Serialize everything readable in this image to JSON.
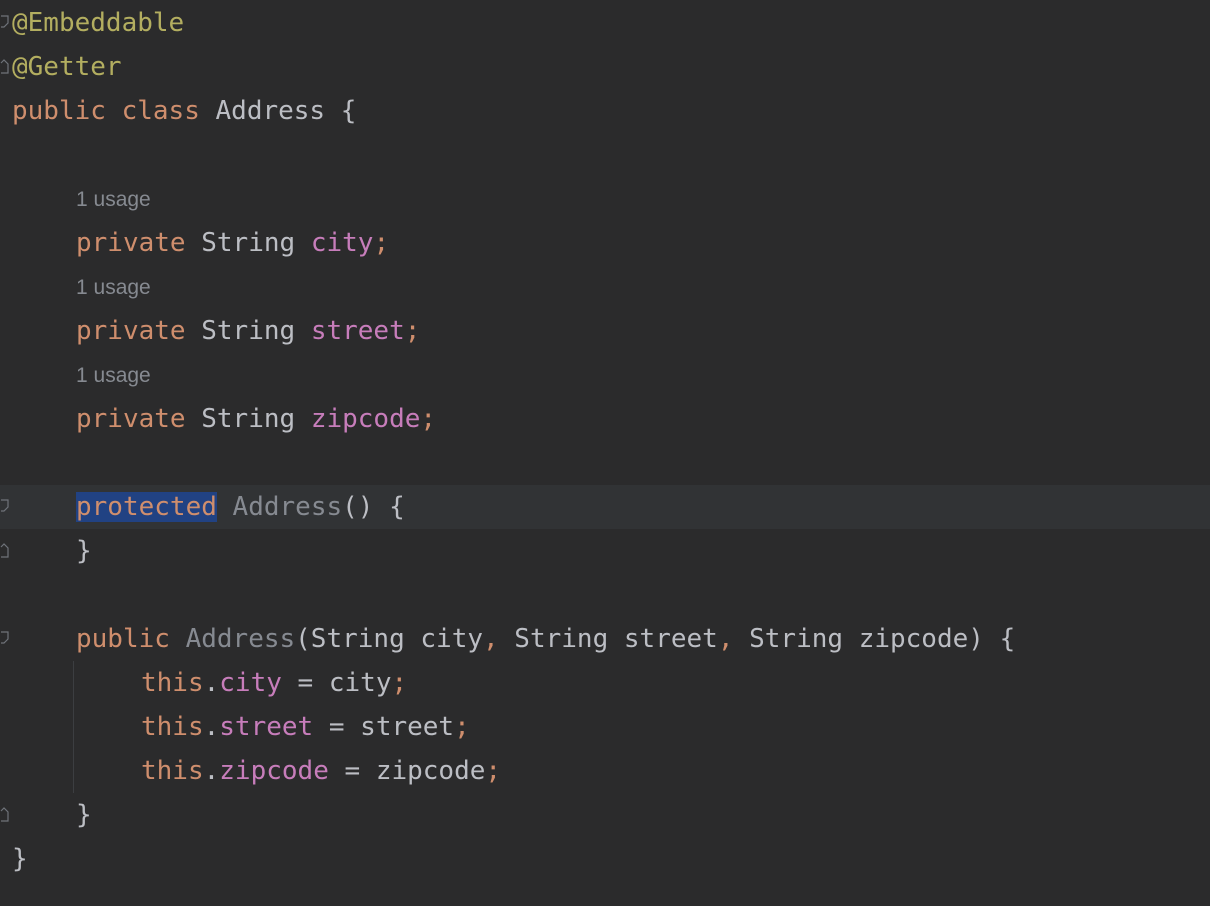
{
  "editor": {
    "lines": {
      "l1": {
        "anno": "@Embeddable"
      },
      "l2": {
        "anno": "@Getter"
      },
      "l3": {
        "kw1": "public",
        "kw2": "class",
        "name": "Address",
        "brace": "{"
      },
      "hint1": "1 usage",
      "l5": {
        "kw": "private",
        "type": "String",
        "field": "city",
        "semi": ";"
      },
      "hint2": "1 usage",
      "l7": {
        "kw": "private",
        "type": "String",
        "field": "street",
        "semi": ";"
      },
      "hint3": "1 usage",
      "l9": {
        "kw": "private",
        "type": "String",
        "field": "zipcode",
        "semi": ";"
      },
      "l11": {
        "kw": "protected",
        "name": "Address",
        "rest": "() {"
      },
      "l12": {
        "brace": "}"
      },
      "l14": {
        "kw": "public",
        "name": "Address",
        "p1": "(String city",
        "c1": ",",
        "p2": " String street",
        "c2": ",",
        "p3": " String zipcode) {"
      },
      "l15": {
        "this": "this",
        "dot": ".",
        "field": "city",
        "rest": " = city",
        "semi": ";"
      },
      "l16": {
        "this": "this",
        "dot": ".",
        "field": "street",
        "rest": " = street",
        "semi": ";"
      },
      "l17": {
        "this": "this",
        "dot": ".",
        "field": "zipcode",
        "rest": " = zipcode",
        "semi": ";"
      },
      "l18": {
        "brace": "}"
      },
      "l19": {
        "brace": "}"
      }
    }
  }
}
